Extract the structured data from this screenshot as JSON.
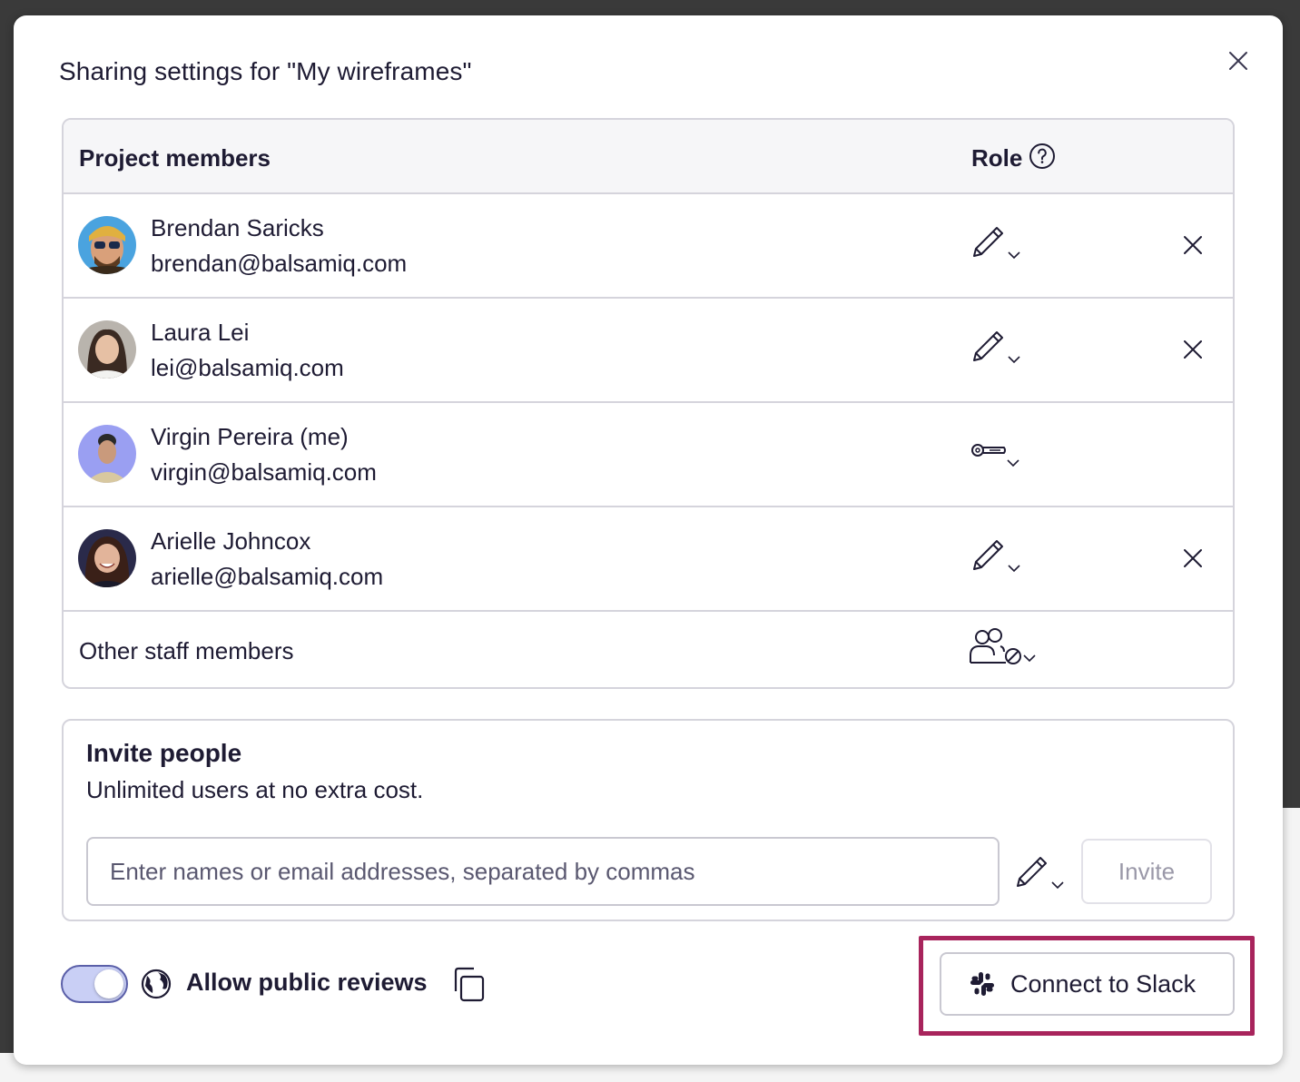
{
  "dialog": {
    "title": "Sharing settings for \"My wireframes\""
  },
  "table": {
    "header_members": "Project members",
    "header_role": "Role",
    "members": [
      {
        "name": "Brendan Saricks",
        "email": "brendan@balsamiq.com",
        "role_icon": "pencil-icon",
        "removable": true
      },
      {
        "name": "Laura Lei",
        "email": "lei@balsamiq.com",
        "role_icon": "pencil-icon",
        "removable": true
      },
      {
        "name": "Virgin Pereira (me)",
        "email": "virgin@balsamiq.com",
        "role_icon": "key-icon",
        "removable": false
      },
      {
        "name": "Arielle Johncox",
        "email": "arielle@balsamiq.com",
        "role_icon": "pencil-icon",
        "removable": true
      }
    ],
    "staff_label": "Other staff members",
    "staff_role_icon": "staff-no-access-icon"
  },
  "invite": {
    "title": "Invite people",
    "subtitle": "Unlimited users at no extra cost.",
    "placeholder": "Enter names or email addresses, separated by commas",
    "button": "Invite"
  },
  "footer": {
    "public_reviews_label": "Allow public reviews",
    "public_reviews_on": true,
    "slack_button": "Connect to Slack"
  },
  "colors": {
    "highlight": "#a8245c",
    "toggle_track": "#c9cff5",
    "border": "#d5d4dc"
  }
}
